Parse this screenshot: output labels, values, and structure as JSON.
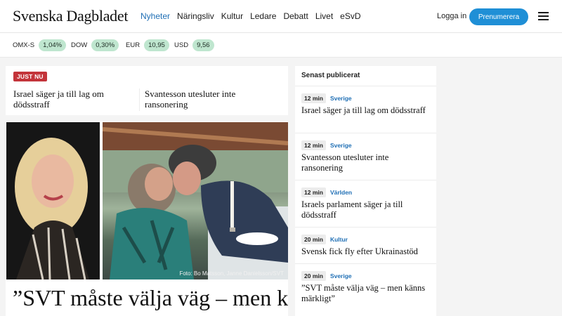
{
  "header": {
    "logo": "Svenska Dagbladet",
    "nav": [
      {
        "label": "Nyheter",
        "active": true
      },
      {
        "label": "Näringsliv",
        "active": false
      },
      {
        "label": "Kultur",
        "active": false
      },
      {
        "label": "Ledare",
        "active": false
      },
      {
        "label": "Debatt",
        "active": false
      },
      {
        "label": "Livet",
        "active": false
      },
      {
        "label": "eSvD",
        "active": false
      }
    ],
    "login_label": "Logga in",
    "subscribe_label": "Prenumerera",
    "menu_icon": "hamburger-menu-icon"
  },
  "ticker": [
    {
      "label": "OMX-S",
      "value": "1,04%"
    },
    {
      "label": "DOW",
      "value": "0,30%"
    },
    {
      "label": "EUR",
      "value": "10,95"
    },
    {
      "label": "USD",
      "value": "9,56"
    }
  ],
  "breaking": {
    "badge": "JUST NU",
    "headlines": [
      "Israel säger ja till lag om dödsstraff",
      "Svantesson utesluter inte ransonering"
    ]
  },
  "hero": {
    "photo_credit": "Foto: Bo Matsson, Janne Danielsson/SVT",
    "title": "”SVT måste välja väg – men känns märkligt”"
  },
  "latest": {
    "title": "Senast publicerat",
    "items": [
      {
        "time": "12 min",
        "category": "Sverige",
        "headline": "Israel säger ja till lag om dödsstraff"
      },
      {
        "time": "12 min",
        "category": "Sverige",
        "headline": "Svantesson utesluter inte ransonering"
      },
      {
        "time": "12 min",
        "category": "Världen",
        "headline": "Israels parlament säger ja till dödsstraff"
      },
      {
        "time": "20 min",
        "category": "Kultur",
        "headline": "Svensk fick fly efter Ukrainastöd"
      },
      {
        "time": "20 min",
        "category": "Sverige",
        "headline": "”SVT måste välja väg – men känns märkligt”"
      }
    ]
  },
  "colors": {
    "accent_blue": "#1f6fb5",
    "subscribe_blue": "#1f8fd6",
    "breaking_red": "#c3343a",
    "ticker_green": "#bfe6cf"
  }
}
